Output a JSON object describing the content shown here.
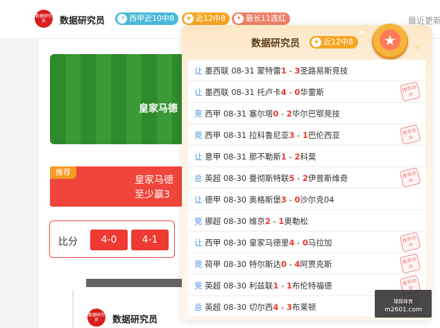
{
  "header": {
    "avatar_text": "数据研究员",
    "name": "数据研究员",
    "tags": [
      {
        "icon": "trend-icon",
        "glyph": "↗",
        "label": "西甲近10中8"
      },
      {
        "icon": "star-icon",
        "glyph": "★",
        "label": "近12中8"
      },
      {
        "icon": "fire-icon",
        "glyph": "✦",
        "label": "最长11连红"
      }
    ],
    "recent_label": "最近更新"
  },
  "main": {
    "banner_title": "皇家马德",
    "promo_badge": "推荐",
    "promo_line1": "皇家马德",
    "promo_line2": "至少赢3",
    "score_label": "比分",
    "score_options": [
      "4-0",
      "4-1"
    ],
    "bottom_name": "数据研究员",
    "bottom_avatar_text": "数据研究员"
  },
  "popup": {
    "title": "数据研究员",
    "tag": {
      "icon": "star-icon",
      "glyph": "★",
      "label": "近12中8"
    },
    "medal_icon": "medal-star-icon",
    "stamp_text": "推荐命中",
    "rows": [
      {
        "type": "让",
        "league": "墨西联",
        "date": "08-31",
        "home": "蒙特雷",
        "hs": "1",
        "as": "3",
        "away": "圣路易斯竞技",
        "hit": false
      },
      {
        "type": "让",
        "league": "墨西联",
        "date": "08-31",
        "home": "托卢卡",
        "hs": "4",
        "as": "0",
        "away": "华雷斯",
        "hit": true
      },
      {
        "type": "竞",
        "league": "西甲",
        "date": "08-31",
        "home": "塞尔塔",
        "hs": "0",
        "as": "2",
        "away": "毕尔巴鄂竞技",
        "hit": false
      },
      {
        "type": "竞",
        "league": "西甲",
        "date": "08-31",
        "home": "拉科鲁尼亚",
        "hs": "3",
        "as": "1",
        "away": "巴伦西亚",
        "hit": true
      },
      {
        "type": "让",
        "league": "意甲",
        "date": "08-31",
        "home": "那不勒斯",
        "hs": "1",
        "as": "2",
        "away": "科莫",
        "hit": false
      },
      {
        "type": "总",
        "league": "英超",
        "date": "08-30",
        "home": "曼彻斯特联",
        "hs": "5",
        "as": "2",
        "away": "伊普斯维奇",
        "hit": true
      },
      {
        "type": "让",
        "league": "德甲",
        "date": "08-30",
        "home": "奥格斯堡",
        "hs": "3",
        "as": "0",
        "away": "沙尔克04",
        "hit": false
      },
      {
        "type": "竞",
        "league": "挪超",
        "date": "08-30",
        "home": "维京",
        "hs": "2",
        "as": "1",
        "away": "奥勒松",
        "hit": false
      },
      {
        "type": "让",
        "league": "西甲",
        "date": "08-30",
        "home": "皇家马德里",
        "hs": "4",
        "as": "0",
        "away": "马拉加",
        "hit": true
      },
      {
        "type": "竞",
        "league": "荷甲",
        "date": "08-30",
        "home": "特尔斯达",
        "hs": "0",
        "as": "4",
        "away": "阿贾克斯",
        "hit": true
      },
      {
        "type": "竞",
        "league": "英超",
        "date": "08-30",
        "home": "利兹联",
        "hs": "1",
        "as": "1",
        "away": "布伦特福德",
        "hit": true
      },
      {
        "type": "总",
        "league": "英超",
        "date": "08-30",
        "home": "切尔西",
        "hs": "4",
        "as": "3",
        "away": "布莱顿",
        "hit": true
      }
    ]
  },
  "watermark": {
    "top": "球探体育",
    "bottom": "m2601.com"
  },
  "colors": {
    "accent_red": "#ef3a33",
    "tag_blue": "#49b9d8",
    "tag_orange": "#f5a623",
    "tag_salmon": "#f0806a",
    "type_blue": "#4a90e2"
  }
}
